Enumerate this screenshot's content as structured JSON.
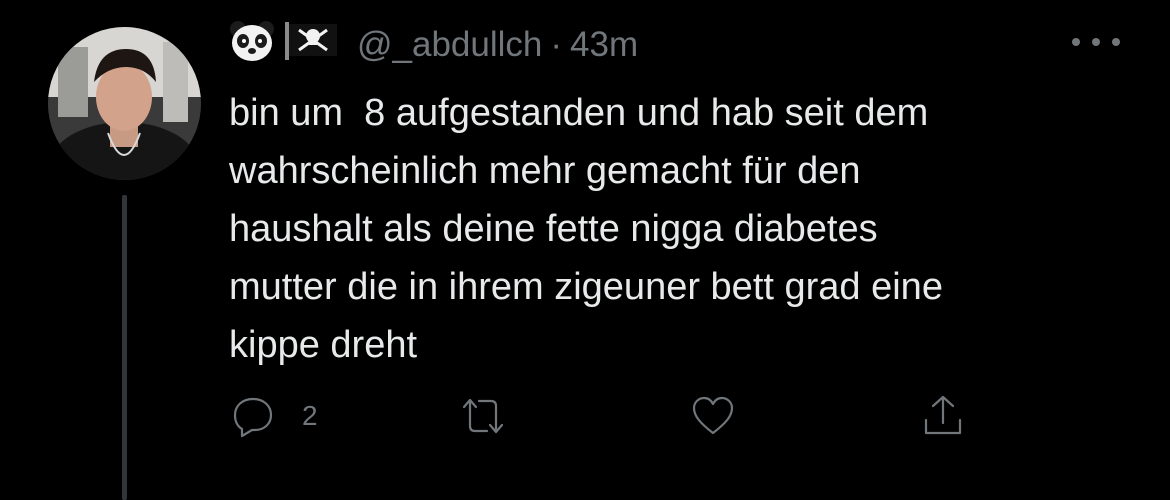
{
  "tweet": {
    "handle": "@_abdullch",
    "separator": "·",
    "time": "43m",
    "name_emojis": [
      "panda-face",
      "pirate-flag"
    ],
    "text": "bin um  8 aufgestanden und hab seit dem\nwahrscheinlich mehr gemacht für den\nhaushalt als deine fette nigga diabetes\nmutter die in ihrem zigeuner bett grad eine\nkippe dreht",
    "reply_count": "2"
  },
  "colors": {
    "background": "#000000",
    "text_primary": "#e7e9ea",
    "text_secondary": "#71767b",
    "thread_line": "#333639"
  }
}
